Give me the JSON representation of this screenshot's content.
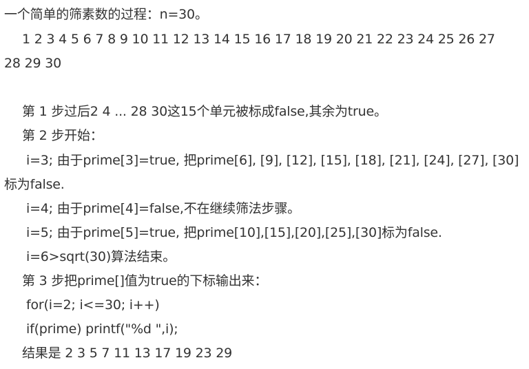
{
  "document": {
    "lines": [
      "一个简单的筛素数的过程：n=30。",
      "1 2 3 4 5 6 7 8 9 10 11 12 13 14 15 16 17 18 19 20 21 22 23 24 25 26 27",
      "28 29 30",
      "第 1 步过后2 4 ... 28 30这15个单元被标成false,其余为true。",
      "第 2 步开始：",
      "i=3;  由于prime[3]=true, 把prime[6], [9], [12], [15], [18], [21], [24], [27], [30]",
      "标为false.",
      "i=4;  由于prime[4]=false,不在继续筛法步骤。",
      "i=5;  由于prime[5]=true, 把prime[10],[15],[20],[25],[30]标为false.",
      "i=6>sqrt(30)算法结束。",
      "第 3 步把prime[]值为true的下标输出来：",
      "for(i=2; i<=30; i++)",
      "if(prime) printf(\"%d \",i);",
      "结果是 2 3 5 7 11 13 17 19 23 29"
    ]
  }
}
